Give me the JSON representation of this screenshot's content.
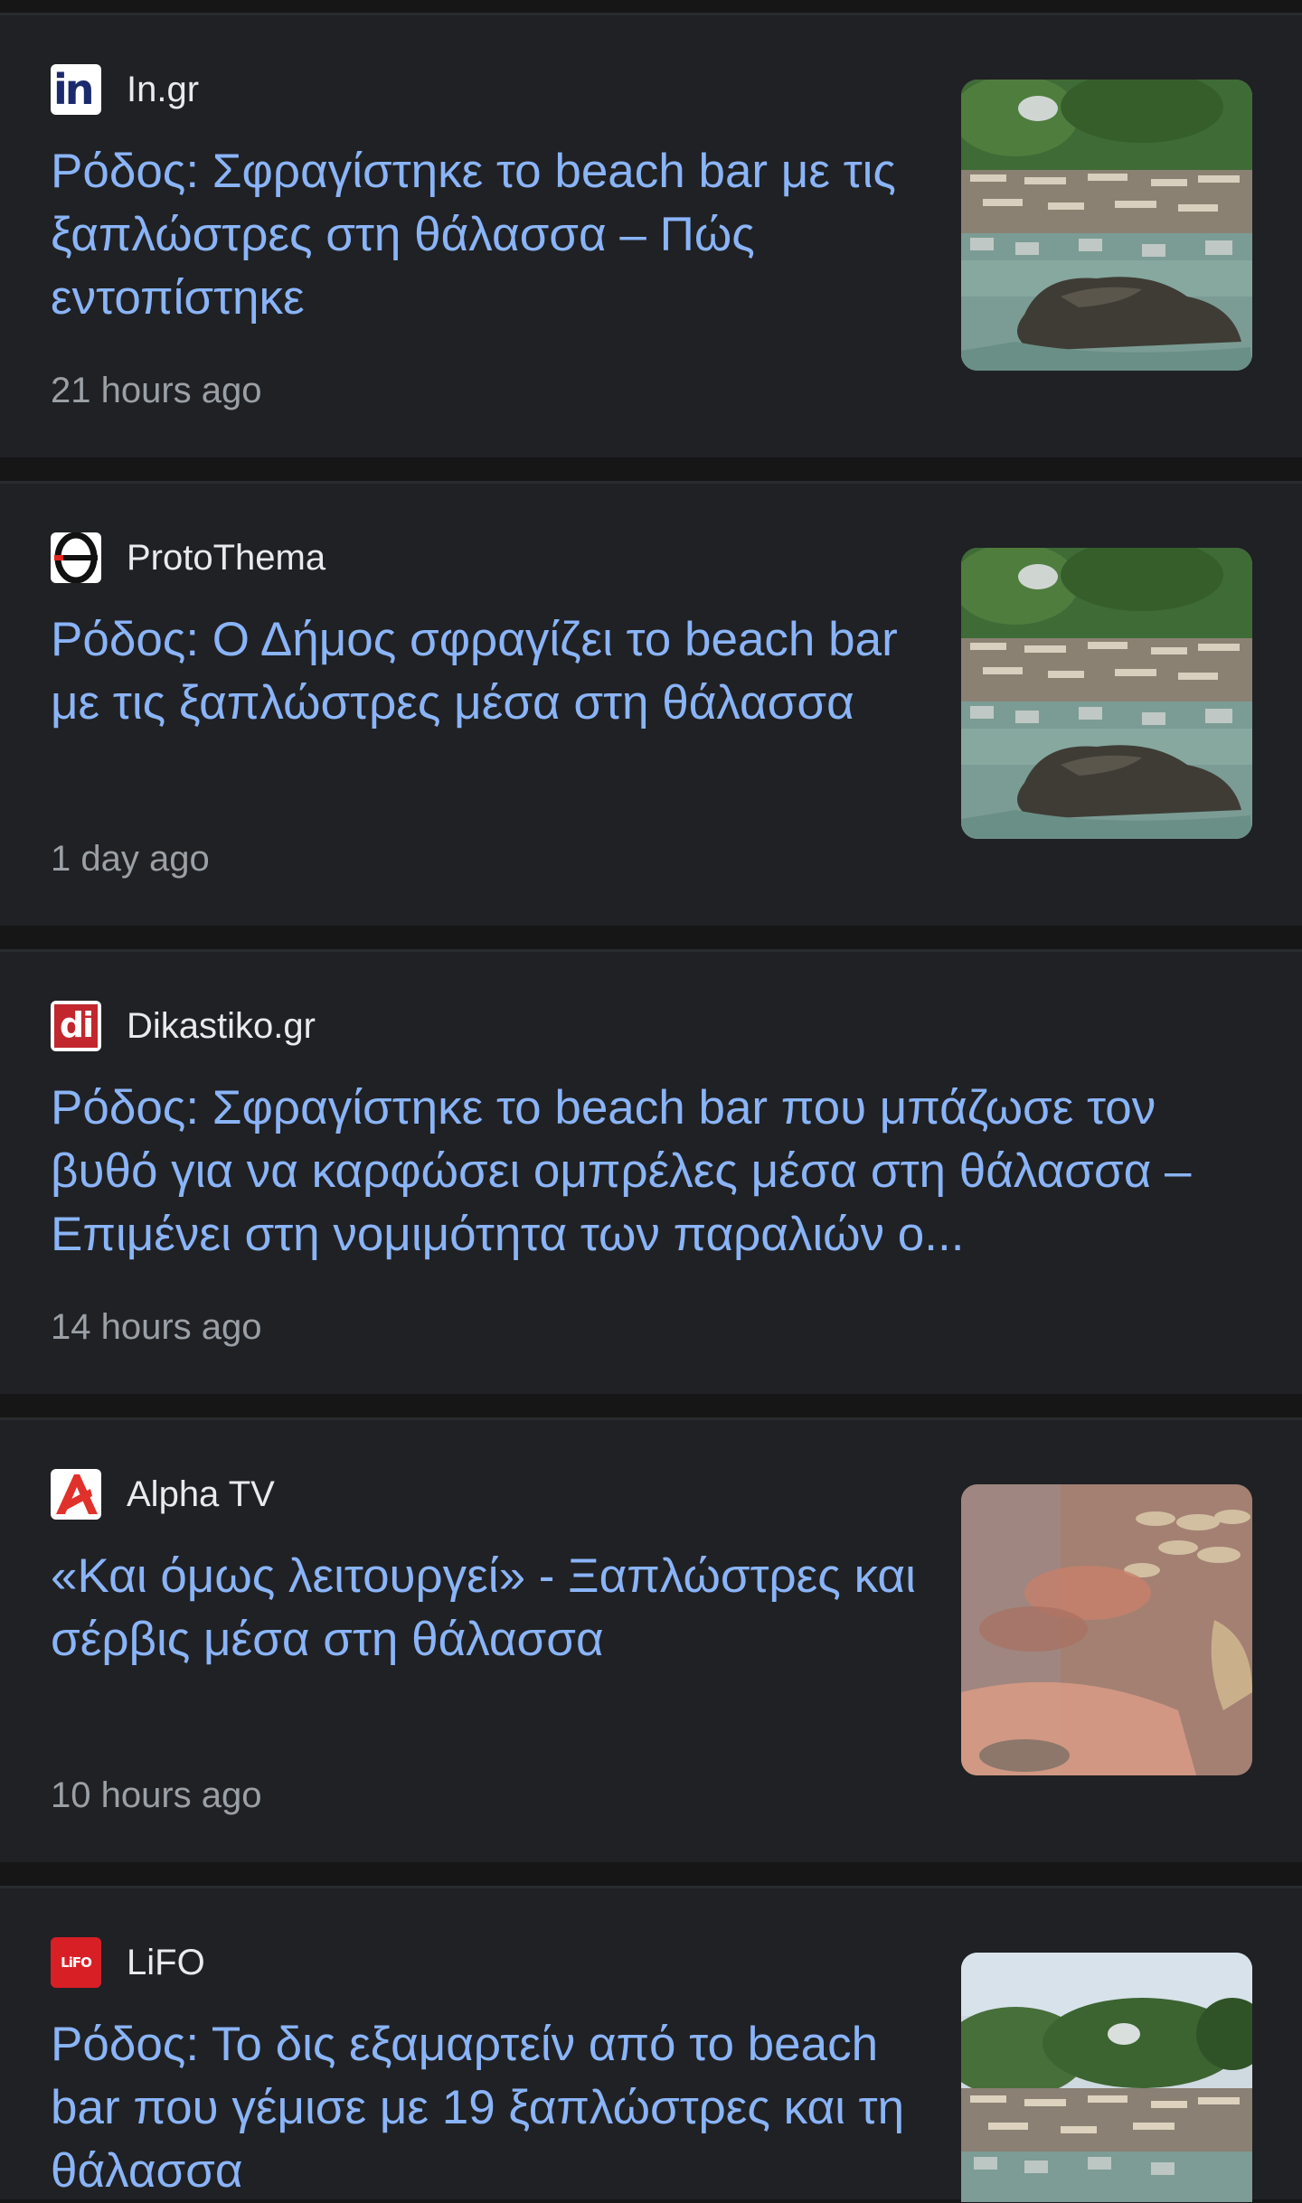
{
  "articles": [
    {
      "source": "In.gr",
      "favicon": "in-gr-logo",
      "favicon_text": "in",
      "headline": "Ρόδος: Σφραγίστηκε το beach bar με τις ξαπλώστρες στη θάλασσα – Πώς εντοπίστηκε",
      "time": "21 hours ago",
      "thumbnail": "beach-bar-rocks-photo"
    },
    {
      "source": "ProtoThema",
      "favicon": "protothema-logo",
      "headline": "Ρόδος: Ο Δήμος σφραγίζει το beach bar με τις ξαπλώστρες μέσα στη θάλασσα",
      "time": "1 day ago",
      "thumbnail": "beach-bar-rocks-photo"
    },
    {
      "source": "Dikastiko.gr",
      "favicon": "dikastiko-logo",
      "favicon_text": "di",
      "headline": "Ρόδος: Σφραγίστηκε το beach bar που μπάζωσε τον βυθό για να καρφώσει ομπρέλες μέσα στη θάλασσα – Επιμένει στη νομιμότητα των παραλιών ο...",
      "time": "14 hours ago"
    },
    {
      "source": "Alpha TV",
      "favicon": "alpha-tv-logo",
      "headline": "«Και όμως λειτουργεί» - Ξαπλώστρες και σέρβις μέσα στη θάλασσα",
      "time": "10 hours ago",
      "thumbnail": "blurred-beach-photo"
    },
    {
      "source": "LiFO",
      "favicon": "lifo-logo",
      "favicon_text": "LiFO",
      "headline": "Ρόδος: Το δις εξαμαρτείν από το beach bar που γέμισε με 19 ξαπλώστρες και τη θάλασσα",
      "thumbnail": "beach-coast-photo"
    }
  ],
  "colors": {
    "background": "#161616",
    "card": "#202124",
    "headline": "#8ab4f8",
    "source": "#e8eaed",
    "time": "#9aa0a6"
  }
}
